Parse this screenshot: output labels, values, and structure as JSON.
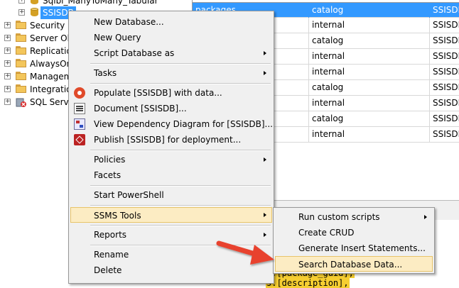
{
  "tree": {
    "items": [
      {
        "label": "Sqlbi_ManyToMany_Tabular",
        "type": "database"
      },
      {
        "label": "SSISDB",
        "type": "database",
        "selected": true
      },
      {
        "label": "Security",
        "type": "folder"
      },
      {
        "label": "Server Obj",
        "type": "folder"
      },
      {
        "label": "Replicatio",
        "type": "folder"
      },
      {
        "label": "AlwaysOn",
        "type": "folder"
      },
      {
        "label": "Managem",
        "type": "folder"
      },
      {
        "label": "Integration",
        "type": "folder"
      },
      {
        "label": "SQL Serve",
        "type": "agent"
      }
    ]
  },
  "grid": {
    "rows": [
      [
        "packages",
        "catalog",
        "SSISDB"
      ],
      [
        "",
        "internal",
        "SSISDB"
      ],
      [
        "",
        "catalog",
        "SSISDB"
      ],
      [
        "",
        "internal",
        "SSISDB"
      ],
      [
        "",
        "internal",
        "SSISDB"
      ],
      [
        "",
        "catalog",
        "SSISDB"
      ],
      [
        "",
        "internal",
        "SSISDB"
      ],
      [
        "",
        "catalog",
        "SSISDB"
      ],
      [
        "",
        "internal",
        "SSISDB"
      ]
    ]
  },
  "editor": {
    "lines": [
      "s.[package_guid],",
      "s.[description],"
    ]
  },
  "context_menu": {
    "items": [
      {
        "label": "New Database...",
        "submenu": false,
        "icon": ""
      },
      {
        "label": "New Query",
        "submenu": false,
        "icon": ""
      },
      {
        "label": "Script Database as",
        "submenu": true,
        "icon": ""
      },
      {
        "label": "Tasks",
        "submenu": true,
        "icon": ""
      },
      {
        "label": "Populate [SSISDB] with data...",
        "submenu": false,
        "icon": "gear-icon"
      },
      {
        "label": "Document [SSISDB]...",
        "submenu": false,
        "icon": "document-icon"
      },
      {
        "label": "View Dependency Diagram for [SSISDB]...",
        "submenu": false,
        "icon": "diagram-icon"
      },
      {
        "label": "Publish [SSISDB] for deployment...",
        "submenu": false,
        "icon": "publish-icon"
      },
      {
        "label": "Policies",
        "submenu": true,
        "icon": ""
      },
      {
        "label": "Facets",
        "submenu": false,
        "icon": ""
      },
      {
        "label": "Start PowerShell",
        "submenu": false,
        "icon": ""
      },
      {
        "label": "SSMS Tools",
        "submenu": true,
        "icon": "",
        "highlighted": true
      },
      {
        "label": "Reports",
        "submenu": true,
        "icon": ""
      },
      {
        "label": "Rename",
        "submenu": false,
        "icon": ""
      },
      {
        "label": "Delete",
        "submenu": false,
        "icon": ""
      }
    ]
  },
  "submenu": {
    "items": [
      {
        "label": "Run custom scripts",
        "submenu": true
      },
      {
        "label": "Create CRUD",
        "submenu": false
      },
      {
        "label": "Generate Insert Statements...",
        "submenu": false
      },
      {
        "label": "Search Database Data...",
        "submenu": false,
        "highlighted": true
      }
    ]
  },
  "colors": {
    "selection": "#3399ff",
    "menu_hover": "#fcecc3",
    "arrow": "#e8432e",
    "code_highlight": "#f6ce31"
  }
}
